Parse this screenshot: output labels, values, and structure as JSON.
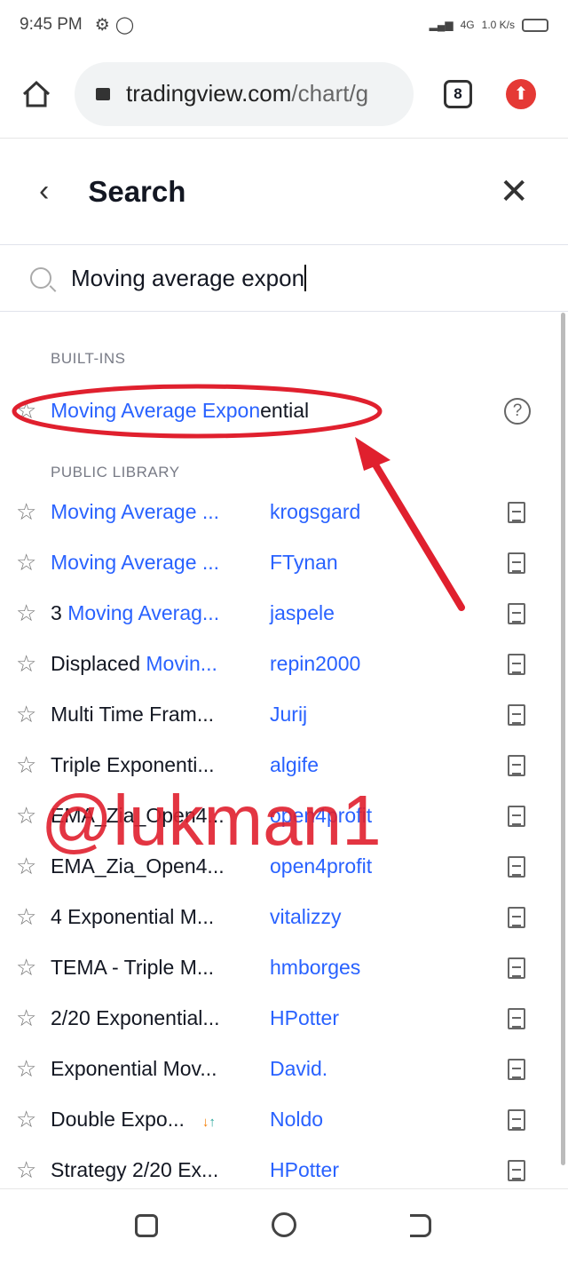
{
  "status_bar": {
    "time": "9:45 PM",
    "network": "4G",
    "speed": "1.0 K/s"
  },
  "browser": {
    "url_host": "tradingview.com",
    "url_path": "/chart/g",
    "tab_count": "8"
  },
  "header": {
    "title": "Search"
  },
  "search": {
    "value": "Moving average expon"
  },
  "builtins": {
    "heading": "BUILT-INS",
    "items": [
      {
        "match": "Moving Average Expon",
        "rest": "ential"
      }
    ]
  },
  "library": {
    "heading": "PUBLIC LIBRARY",
    "items": [
      {
        "pre": "",
        "match": "Moving Average",
        "post": " ...",
        "author": "krogsgard"
      },
      {
        "pre": "",
        "match": "Moving Average",
        "post": " ...",
        "author": "FTynan"
      },
      {
        "pre": "3 ",
        "match": "Moving Averag...",
        "post": "",
        "author": "jaspele"
      },
      {
        "pre": "Displaced ",
        "match": "Movin...",
        "post": "",
        "author": "repin2000"
      },
      {
        "pre": "Multi Time Fram...",
        "match": "",
        "post": "",
        "author": "Jurij"
      },
      {
        "pre": "Triple Exponenti...",
        "match": "",
        "post": "",
        "author": "algife"
      },
      {
        "pre": "EMA_Zia_Open4...",
        "match": "",
        "post": "",
        "author": "open4profit"
      },
      {
        "pre": "EMA_Zia_Open4...",
        "match": "",
        "post": "",
        "author": "open4profit"
      },
      {
        "pre": "4 Exponential M...",
        "match": "",
        "post": "",
        "author": "vitalizzy"
      },
      {
        "pre": "TEMA - Triple M...",
        "match": "",
        "post": "",
        "author": "hmborges"
      },
      {
        "pre": "2/20 Exponential...",
        "match": "",
        "post": "",
        "author": "HPotter"
      },
      {
        "pre": "Exponential Mov...",
        "match": "",
        "post": "",
        "author": "David."
      },
      {
        "pre": "Double Expo...",
        "match": "",
        "post": "",
        "author": "Noldo",
        "badge": "strategy-arrows"
      },
      {
        "pre": "Strategy 2/20 Ex...",
        "match": "",
        "post": "",
        "author": "HPotter"
      }
    ]
  },
  "watermark": "@lukman1",
  "annotation_color": "#e0202e",
  "accent": "#2962ff"
}
